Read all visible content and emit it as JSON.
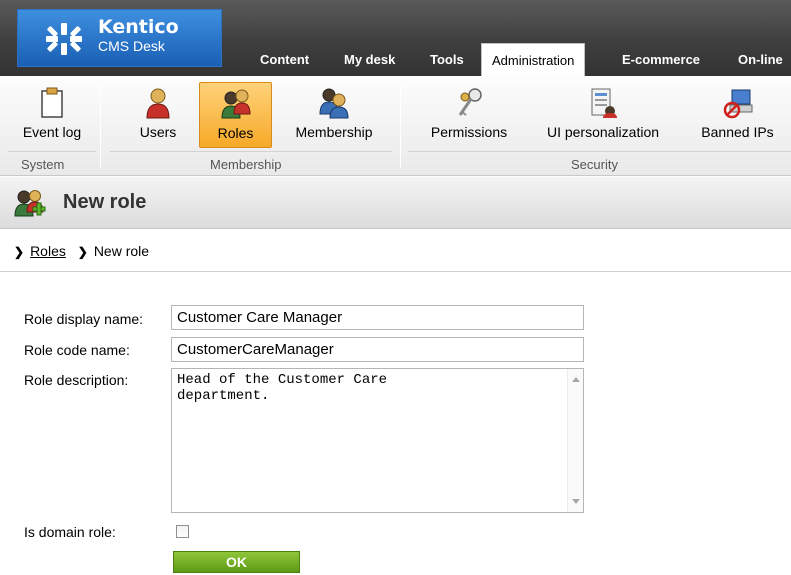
{
  "header": {
    "logo_brand": "Kentico",
    "logo_product": "CMS Desk",
    "tabs": [
      {
        "label": "Content"
      },
      {
        "label": "My desk"
      },
      {
        "label": "Tools"
      },
      {
        "label": "Administration",
        "active": true
      },
      {
        "label": "E-commerce"
      },
      {
        "label": "On-line"
      }
    ]
  },
  "ribbon": {
    "groups": [
      {
        "label": "System",
        "items": [
          {
            "label": "Event log",
            "icon": "clipboard-icon"
          }
        ]
      },
      {
        "label": "Membership",
        "items": [
          {
            "label": "Users",
            "icon": "user-icon"
          },
          {
            "label": "Roles",
            "icon": "roles-icon",
            "selected": true
          },
          {
            "label": "Membership",
            "icon": "membership-icon"
          }
        ]
      },
      {
        "label": "Security",
        "items": [
          {
            "label": "Permissions",
            "icon": "keys-icon"
          },
          {
            "label": "UI personalization",
            "icon": "ui-personalization-icon"
          },
          {
            "label": "Banned IPs",
            "icon": "banned-ip-icon"
          }
        ]
      }
    ]
  },
  "page": {
    "title": "New role"
  },
  "breadcrumb": {
    "link": "Roles",
    "current": "New role"
  },
  "form": {
    "display_name_label": "Role display name:",
    "display_name_value": "Customer Care Manager",
    "code_name_label": "Role code name:",
    "code_name_value": "CustomerCareManager",
    "description_label": "Role description:",
    "description_value": "Head of the Customer Care\ndepartment.",
    "domain_role_label": "Is domain role:",
    "domain_role_checked": false,
    "ok_label": "OK"
  },
  "colors": {
    "header_bg": "#3e3e3e",
    "logo_blue": "#1a5fb4",
    "selected_orange": "#f6a928",
    "ok_green": "#6aa31e"
  }
}
